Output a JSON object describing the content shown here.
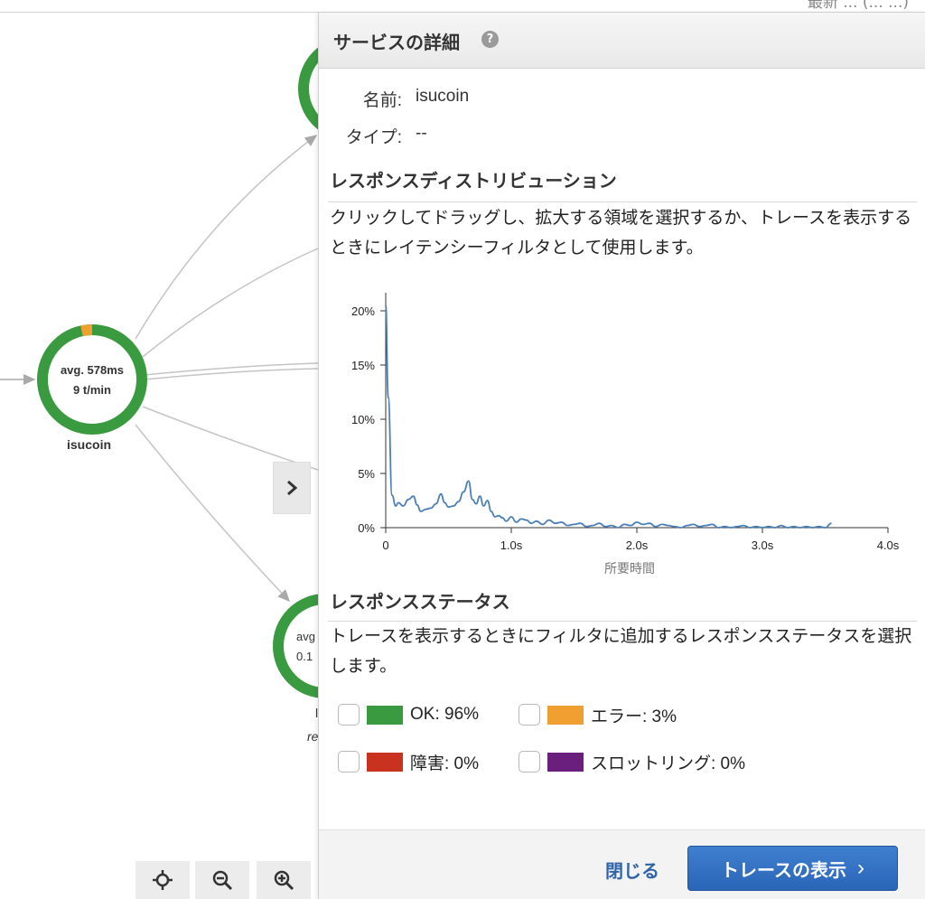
{
  "top_strip": {
    "partial_text": "最新 ... (... ...)"
  },
  "map": {
    "main_node": {
      "name": "isucoin",
      "avg": "avg. 578ms",
      "rate": "9 t/min"
    },
    "lower_node": {
      "avg_partial": "avg",
      "rate_partial": "0.1",
      "label_partial": "l",
      "sub_partial": "re"
    },
    "colors": {
      "ok": "#3a9a3f",
      "error": "#f0a030",
      "edge": "#c0c0c0"
    },
    "tools": [
      {
        "icon": "crosshair-icon"
      },
      {
        "icon": "zoom-out-icon"
      },
      {
        "icon": "zoom-in-icon"
      }
    ],
    "expand_icon": "chevron-right-icon"
  },
  "panel": {
    "title": "サービスの詳細",
    "help_icon": "?",
    "name_key": "名前:",
    "name_value": "isucoin",
    "type_key": "タイプ:",
    "type_value": "--",
    "distribution": {
      "title": "レスポンスディストリビューション",
      "desc": "クリックしてドラッグし、拡大する領域を選択するか、トレースを表示するときにレイテンシーフィルタとして使用します。"
    },
    "status": {
      "title": "レスポンスステータス",
      "desc": "トレースを表示するときにフィルタに追加するレスポンスステータスを選択します。",
      "items": [
        {
          "label": "OK: 96%",
          "color": "#3a9a3f"
        },
        {
          "label": "エラー: 3%",
          "color": "#f0a030"
        },
        {
          "label": "障害: 0%",
          "color": "#c8321e"
        },
        {
          "label": "スロットリング: 0%",
          "color": "#6b1f7c"
        }
      ]
    },
    "footer": {
      "close_label": "閉じる",
      "view_traces_label": "トレースの表示",
      "view_traces_icon": "›"
    }
  },
  "chart_data": {
    "type": "line",
    "xlabel": "所要時間",
    "ylabel": "",
    "xlim": [
      0,
      4.0
    ],
    "ylim": [
      0,
      21
    ],
    "x_ticks": [
      "0",
      "1.0s",
      "2.0s",
      "3.0s",
      "4.0s"
    ],
    "y_ticks": [
      "0%",
      "5%",
      "10%",
      "15%",
      "20%"
    ],
    "series": [
      {
        "color": "#4a7fb8",
        "x": [
          0.0,
          0.02,
          0.05,
          0.08,
          0.1,
          0.14,
          0.18,
          0.22,
          0.25,
          0.28,
          0.32,
          0.36,
          0.4,
          0.44,
          0.47,
          0.5,
          0.54,
          0.58,
          0.62,
          0.66,
          0.69,
          0.72,
          0.75,
          0.78,
          0.81,
          0.84,
          0.87,
          0.9,
          0.93,
          0.96,
          1.0,
          1.04,
          1.08,
          1.12,
          1.16,
          1.2,
          1.25,
          1.3,
          1.35,
          1.4,
          1.45,
          1.5,
          1.55,
          1.6,
          1.65,
          1.7,
          1.75,
          1.8,
          1.85,
          1.9,
          1.95,
          2.0,
          2.05,
          2.1,
          2.15,
          2.2,
          2.25,
          2.3,
          2.35,
          2.4,
          2.45,
          2.5,
          2.55,
          2.6,
          2.65,
          2.7,
          2.75,
          2.8,
          2.85,
          2.9,
          2.95,
          3.0,
          3.05,
          3.1,
          3.15,
          3.2,
          3.25,
          3.3,
          3.35,
          3.4,
          3.45,
          3.5,
          3.55
        ],
        "y": [
          20.5,
          12.0,
          3.0,
          2.0,
          2.3,
          2.0,
          2.6,
          2.9,
          2.1,
          1.5,
          1.7,
          1.8,
          2.2,
          3.1,
          2.3,
          1.9,
          2.0,
          2.4,
          3.3,
          4.3,
          2.6,
          2.2,
          2.9,
          2.0,
          2.5,
          1.5,
          1.0,
          1.1,
          0.9,
          0.6,
          1.0,
          0.5,
          0.8,
          0.7,
          0.4,
          0.6,
          0.3,
          0.7,
          0.4,
          0.5,
          0.2,
          0.3,
          0.4,
          0.1,
          0.2,
          0.4,
          0.1,
          0.2,
          0.0,
          0.3,
          0.2,
          0.5,
          0.3,
          0.4,
          0.1,
          0.3,
          0.2,
          0.1,
          0.0,
          0.2,
          0.3,
          0.1,
          0.2,
          0.3,
          0.0,
          0.1,
          0.0,
          0.1,
          0.2,
          0.0,
          0.1,
          0.0,
          0.1,
          0.0,
          0.2,
          0.0,
          0.1,
          0.0,
          0.1,
          0.0,
          0.1,
          0.0,
          0.4
        ]
      }
    ]
  }
}
